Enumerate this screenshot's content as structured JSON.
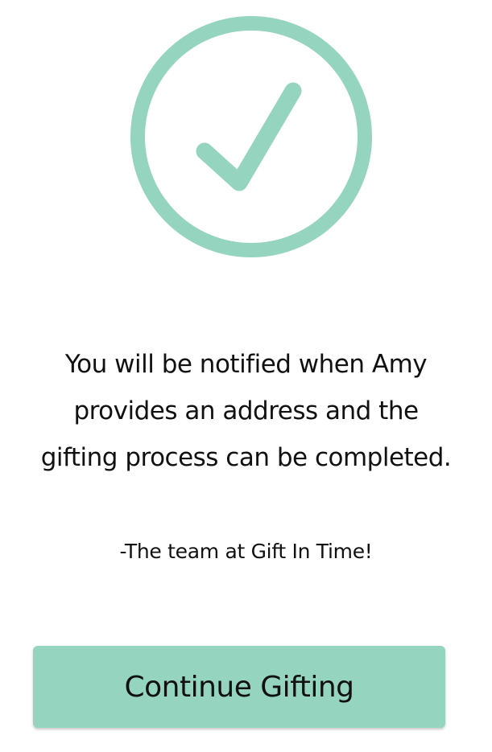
{
  "confirmation": {
    "icon": "checkmark-circle-icon",
    "accent_color": "#95d4bf",
    "message": "You will be notified when Amy provides an address and the gifting process can be completed.",
    "signature": "-The team at Gift In Time!"
  },
  "actions": {
    "continue_label": "Continue Gifting"
  }
}
